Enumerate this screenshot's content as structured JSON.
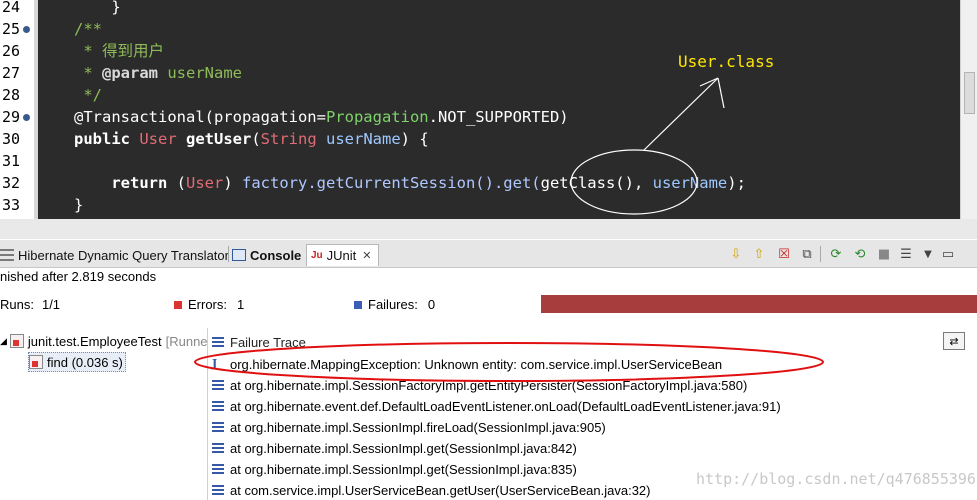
{
  "editor": {
    "lines": [
      {
        "num": "24",
        "fold": false,
        "parts": [
          {
            "t": "    }",
            "c": "c-white"
          }
        ]
      },
      {
        "num": "25",
        "fold": true,
        "parts": [
          {
            "t": "/**",
            "c": "c-comment"
          }
        ]
      },
      {
        "num": "26",
        "fold": false,
        "parts": [
          {
            "t": " * 得到用户",
            "c": "c-comment"
          }
        ]
      },
      {
        "num": "27",
        "fold": false,
        "parts": [
          {
            "t": " * ",
            "c": "c-comment"
          },
          {
            "t": "@param",
            "c": "c-tag"
          },
          {
            "t": " userName",
            "c": "c-comment"
          }
        ]
      },
      {
        "num": "28",
        "fold": false,
        "parts": [
          {
            "t": " */",
            "c": "c-comment"
          }
        ]
      },
      {
        "num": "29",
        "fold": true,
        "parts": [
          {
            "t": "@Transactional(propagation=",
            "c": "c-white"
          },
          {
            "t": "Propagation",
            "c": "c-enum"
          },
          {
            "t": ".NOT_SUPPORTED)",
            "c": "c-field"
          }
        ]
      },
      {
        "num": "30",
        "fold": false,
        "parts": [
          {
            "t": "public ",
            "c": "c-bold"
          },
          {
            "t": "User ",
            "c": "c-type"
          },
          {
            "t": "getUser",
            "c": "c-bold"
          },
          {
            "t": "(",
            "c": "c-white"
          },
          {
            "t": "String ",
            "c": "c-type"
          },
          {
            "t": "userName",
            "c": "c-param"
          },
          {
            "t": ") {",
            "c": "c-white"
          }
        ]
      },
      {
        "num": "31",
        "fold": false,
        "parts": [
          {
            "t": "",
            "c": "c-white"
          }
        ]
      },
      {
        "num": "32",
        "fold": false,
        "parts": [
          {
            "t": "    ",
            "c": "c-white"
          },
          {
            "t": "return ",
            "c": "c-bold"
          },
          {
            "t": "(",
            "c": "c-white"
          },
          {
            "t": "User",
            "c": "c-type"
          },
          {
            "t": ") ",
            "c": "c-white"
          },
          {
            "t": "factory",
            "c": "c-method"
          },
          {
            "t": ".getCurrentSession().get(",
            "c": "c-method"
          },
          {
            "t": "getClass(), ",
            "c": "c-white"
          },
          {
            "t": "userName",
            "c": "c-param"
          },
          {
            "t": ");",
            "c": "c-white"
          }
        ]
      },
      {
        "num": "33",
        "fold": false,
        "parts": [
          {
            "t": "}",
            "c": "c-white"
          }
        ]
      }
    ],
    "annotation_label": "User.class"
  },
  "tabs": {
    "hibernate": "Hibernate Dynamic Query Translator",
    "console": "Console",
    "junit": "JUnit",
    "close": "✕"
  },
  "status": {
    "finished": "nished after 2.819 seconds",
    "runs_label": "Runs:",
    "runs_value": "1/1",
    "errors_label": "Errors:",
    "errors_value": "1",
    "failures_label": "Failures:",
    "failures_value": "0"
  },
  "tree": {
    "root": "junit.test.EmployeeTest",
    "root_suffix": "[Runne",
    "child": "find (0.036 s)"
  },
  "trace": {
    "header": "Failure Trace",
    "rows": [
      "org.hibernate.MappingException: Unknown entity: com.service.impl.UserServiceBean",
      "at org.hibernate.impl.SessionFactoryImpl.getEntityPersister(SessionFactoryImpl.java:580)",
      "at org.hibernate.event.def.DefaultLoadEventListener.onLoad(DefaultLoadEventListener.java:91)",
      "at org.hibernate.impl.SessionImpl.fireLoad(SessionImpl.java:905)",
      "at org.hibernate.impl.SessionImpl.get(SessionImpl.java:842)",
      "at org.hibernate.impl.SessionImpl.get(SessionImpl.java:835)",
      "at com.service.impl.UserServiceBean.getUser(UserServiceBean.java:32)"
    ]
  },
  "watermark": "http://blog.csdn.net/q476855396",
  "colors": {
    "editor_bg": "#2b2b2b",
    "progress_error": "#a73d3d",
    "annotation_yellow": "#ffe600",
    "highlight_red": "#e01010"
  }
}
